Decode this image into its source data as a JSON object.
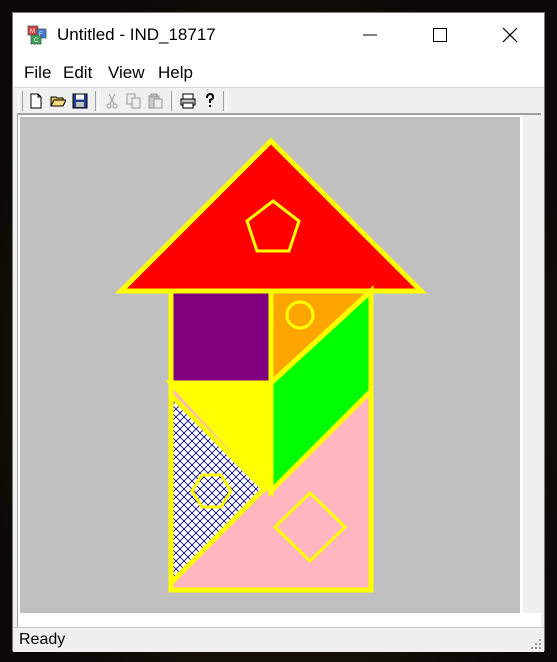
{
  "window": {
    "title": "Untitled - IND_18717"
  },
  "menu": {
    "items": [
      "File",
      "Edit",
      "View",
      "Help"
    ]
  },
  "toolbar": {
    "buttons": [
      "new-icon",
      "open-icon",
      "save-icon",
      "cut-icon",
      "copy-icon",
      "paste-icon",
      "print-icon",
      "help-icon"
    ]
  },
  "status": {
    "text": "Ready"
  },
  "colors": {
    "canvas": "#c0c0c0",
    "outline": "#ffff00",
    "roof": "#ff0000",
    "purple": "#800080",
    "orange": "#ffa500",
    "green": "#00ff00",
    "yellow": "#ffff00",
    "pink": "#ffb6c1",
    "hatch": "#000080"
  }
}
